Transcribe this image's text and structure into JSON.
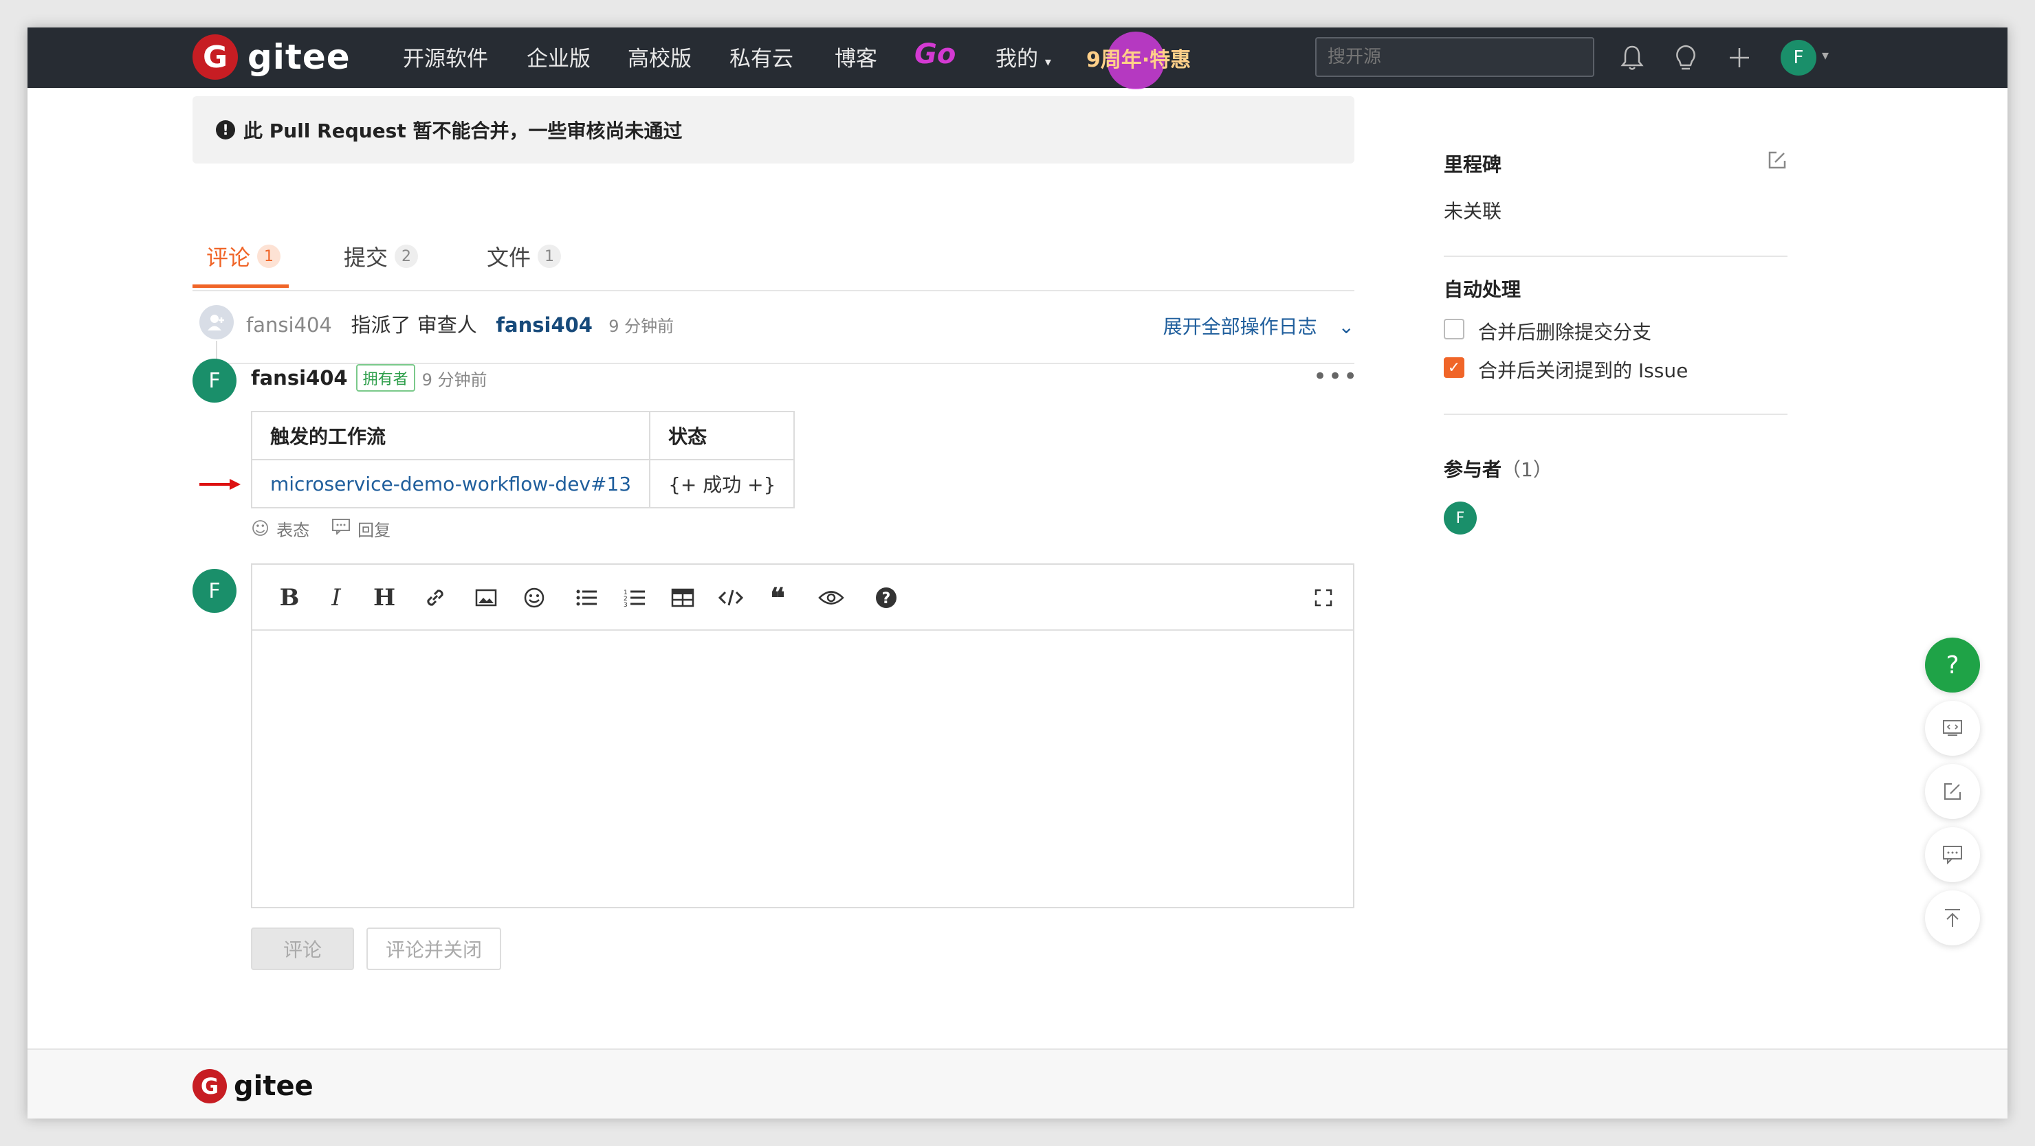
{
  "nav": {
    "brand": "gitee",
    "items": [
      "开源软件",
      "企业版",
      "高校版",
      "私有云",
      "博客"
    ],
    "go": "Go",
    "mine": "我的",
    "promo": "9周年·特惠",
    "search_placeholder": "搜开源",
    "user_initial": "F"
  },
  "alert": {
    "text": "此 Pull Request 暂不能合并，一些审核尚未通过"
  },
  "tabs": [
    {
      "label": "评论",
      "count": "1"
    },
    {
      "label": "提交",
      "count": "2"
    },
    {
      "label": "文件",
      "count": "1"
    }
  ],
  "event": {
    "user": "fansi404",
    "action": "指派了 审查人",
    "target": "fansi404",
    "time": "9 分钟前",
    "expand": "展开全部操作日志"
  },
  "comment": {
    "initial": "F",
    "author": "fansi404",
    "badge": "拥有者",
    "time": "9 分钟前",
    "table": {
      "headers": [
        "触发的工作流",
        "状态"
      ],
      "row": [
        "microservice-demo-workflow-dev#13",
        "{+ 成功 +}"
      ]
    },
    "react": "表态",
    "reply": "回复"
  },
  "editor": {
    "initial": "F"
  },
  "buttons": {
    "comment": "评论",
    "comment_close": "评论并关闭"
  },
  "sidebar": {
    "milestone_title": "里程碑",
    "milestone_value": "未关联",
    "auto_title": "自动处理",
    "auto_opt1": "合并后删除提交分支",
    "auto_opt2": "合并后关闭提到的 Issue",
    "participants_title": "参与者",
    "participants_count": "（1）",
    "participant_initial": "F"
  },
  "footer": {
    "brand": "gitee"
  },
  "colors": {
    "accent": "#f06528",
    "nav": "#272c33",
    "brand": "#c71d23",
    "avatar": "#1a8f6a",
    "fab": "#1fa347"
  }
}
